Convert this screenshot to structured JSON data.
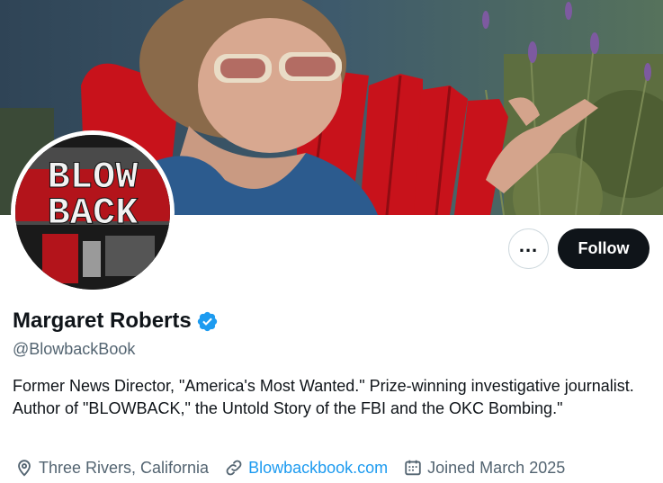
{
  "profile": {
    "name": "Margaret Roberts",
    "handle": "@BlowbackBook",
    "bio": "Former News Director, \"America's Most Wanted.\" Prize-winning investigative journalist. Author of \"BLOWBACK,\" the Untold Story of the FBI and the OKC Bombing.\"",
    "location": "Three Rivers, California",
    "website": "Blowbackbook.com",
    "joined": "Joined March 2025",
    "verified": true
  },
  "avatar": {
    "logo_line1": "BLOW",
    "logo_line2": "BACK"
  },
  "actions": {
    "more_label": "...",
    "follow_label": "Follow"
  },
  "icons": {
    "more": "more-icon",
    "verified": "verified-badge-icon",
    "location": "location-pin-icon",
    "website": "link-icon",
    "joined": "calendar-icon"
  },
  "colors": {
    "accent": "#1d9bf0",
    "text": "#0f1419",
    "secondary": "#536471",
    "follow_bg": "#0f1419",
    "chair_red": "#c8121b"
  }
}
